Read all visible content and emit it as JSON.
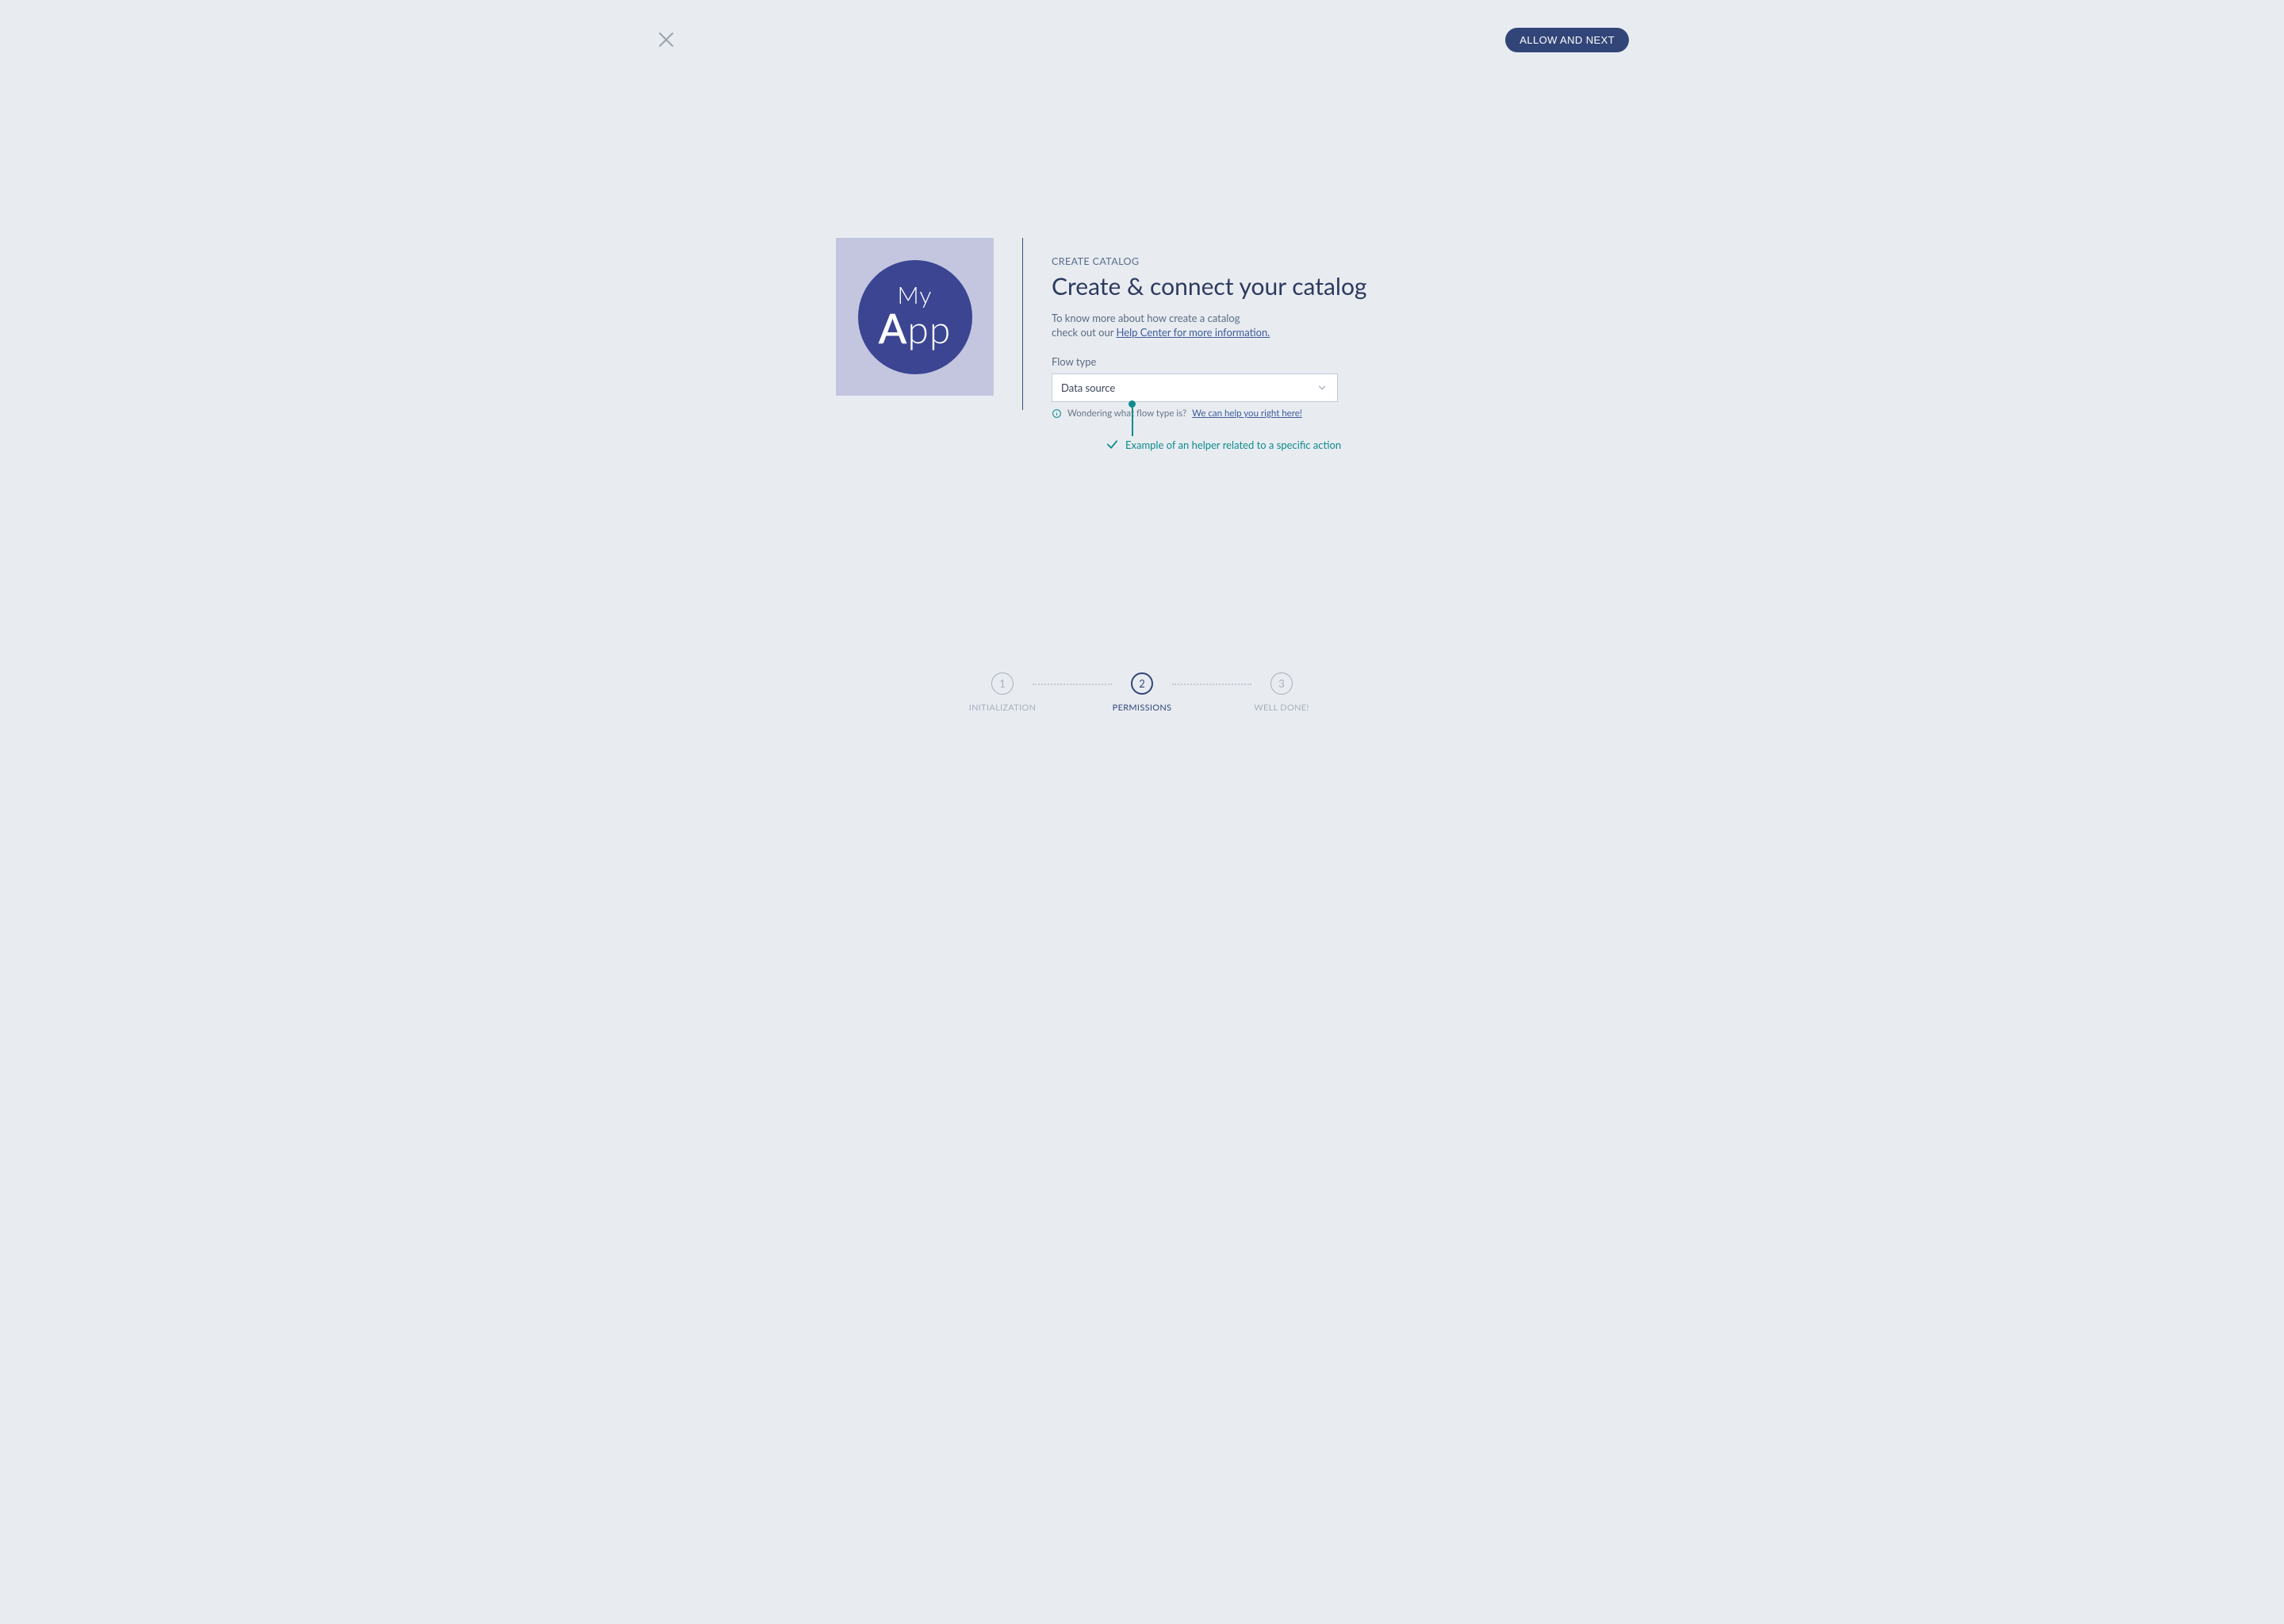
{
  "header": {
    "primary_button": "ALLOW AND NEXT"
  },
  "logo": {
    "line1": "My",
    "line2_bold": "A",
    "line2_rest": "pp"
  },
  "main": {
    "eyebrow": "CREATE CATALOG",
    "title": "Create & connect your catalog",
    "desc_line1": "To know more about how create a catalog",
    "desc_line2_prefix": "check out our ",
    "desc_link": "Help Center for more information.",
    "field_label": "Flow type",
    "select_value": "Data source",
    "hint_text": "Wondering what flow type is?",
    "hint_link": "We can help you right here!",
    "helper_caption": "Example of an helper related to a specific action"
  },
  "stepper": {
    "steps": [
      {
        "num": "1",
        "label": "INITIALIZATION"
      },
      {
        "num": "2",
        "label": "PERMISSIONS"
      },
      {
        "num": "3",
        "label": "WELL DONE!"
      }
    ],
    "active_index": 1
  }
}
